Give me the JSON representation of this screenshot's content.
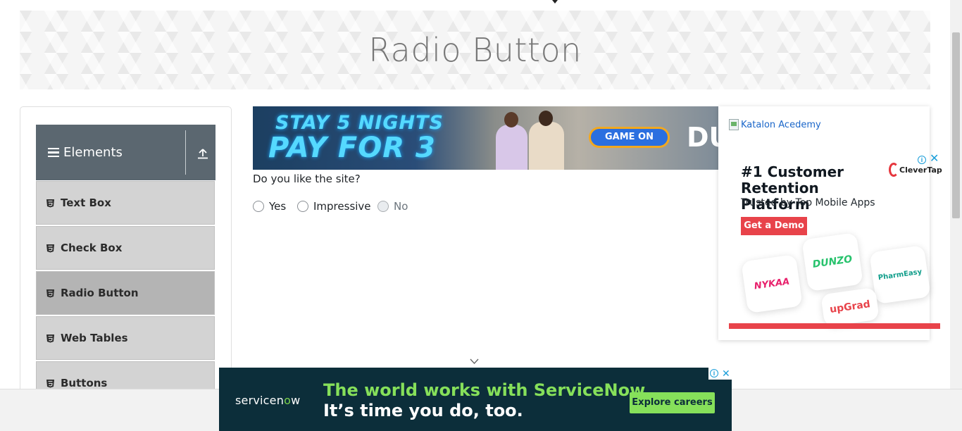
{
  "page": {
    "title": "Radio Button"
  },
  "sidebar": {
    "group_title": "Elements",
    "items": [
      {
        "label": "Text Box",
        "active": false
      },
      {
        "label": "Check Box",
        "active": false
      },
      {
        "label": "Radio Button",
        "active": true
      },
      {
        "label": "Web Tables",
        "active": false
      },
      {
        "label": "Buttons",
        "active": false
      }
    ]
  },
  "top_ad": {
    "line1": "STAY 5 NIGHTS",
    "line2": "PAY FOR 3",
    "cta": "GAME ON",
    "brand_fragment": "DU"
  },
  "main": {
    "question": "Do you like the site?",
    "options": [
      {
        "label": "Yes",
        "checked": false,
        "disabled": false
      },
      {
        "label": "Impressive",
        "checked": false,
        "disabled": false
      },
      {
        "label": "No",
        "checked": false,
        "disabled": true
      }
    ]
  },
  "right_ad": {
    "broken_image_alt": "Katalon Acedemy",
    "headline": "#1 Customer Retention Platform",
    "subline": "Trusted by Top Mobile Apps",
    "cta": "Get a Demo",
    "logo_text": "CleverTap",
    "tiles": [
      "NYKAA",
      "DUNZO",
      "PharmEasy",
      "upGrad"
    ]
  },
  "bottom_ad": {
    "logo": "servicenow",
    "line1": "The world works with ServiceNow.",
    "line2": "It’s time you do, too.",
    "cta": "Explore careers"
  }
}
